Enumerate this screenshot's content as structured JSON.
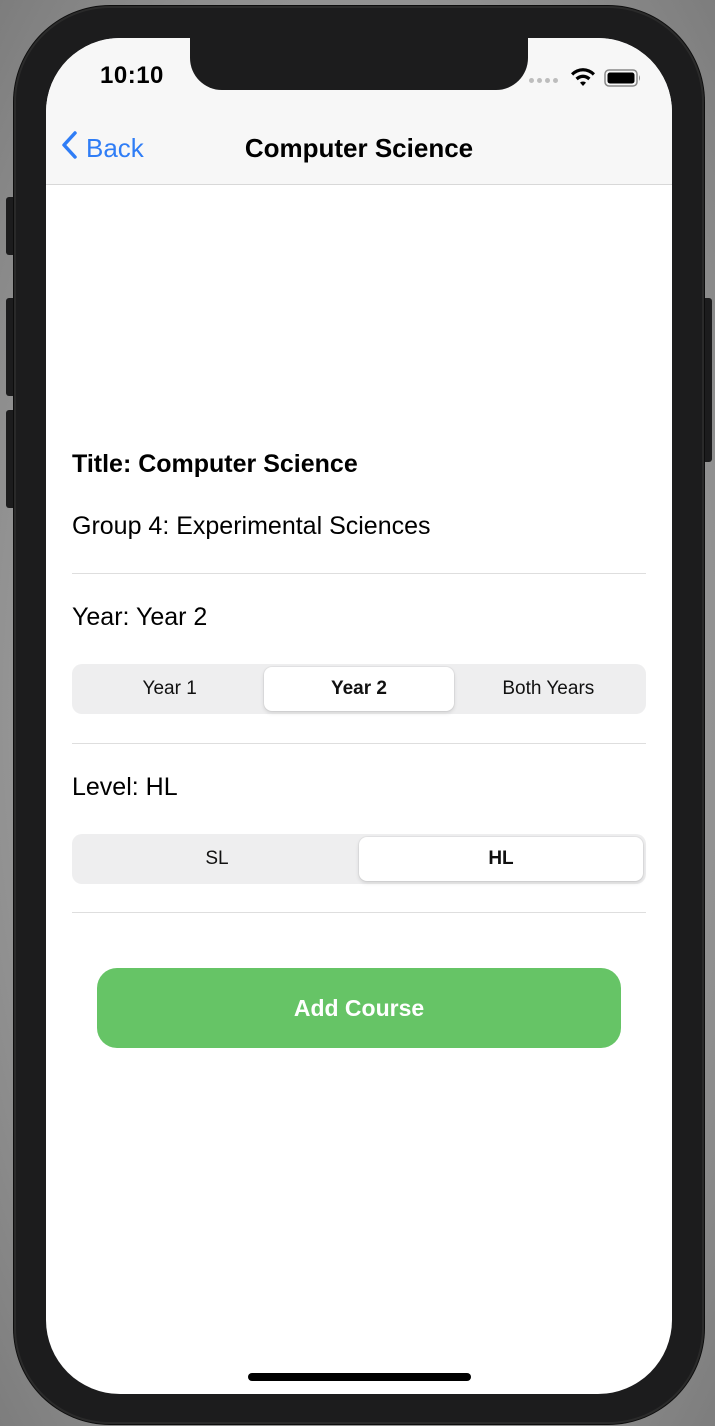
{
  "status_bar": {
    "time": "10:10"
  },
  "nav": {
    "back_label": "Back",
    "title": "Computer Science"
  },
  "course": {
    "title_line": "Title: Computer Science",
    "group_line": "Group 4: Experimental Sciences"
  },
  "year": {
    "label": "Year: Year 2",
    "options": [
      "Year 1",
      "Year 2",
      "Both Years"
    ],
    "selected": "Year 2"
  },
  "level": {
    "label": "Level: HL",
    "options": [
      "SL",
      "HL"
    ],
    "selected": "HL"
  },
  "add_button": {
    "label": "Add Course",
    "color": "#66c466"
  },
  "icons": {
    "back": "chevron-left-icon",
    "wifi": "wifi-icon",
    "battery": "battery-icon",
    "signal": "cellular-signal-icon"
  },
  "colors": {
    "accent": "#2f7df6"
  }
}
